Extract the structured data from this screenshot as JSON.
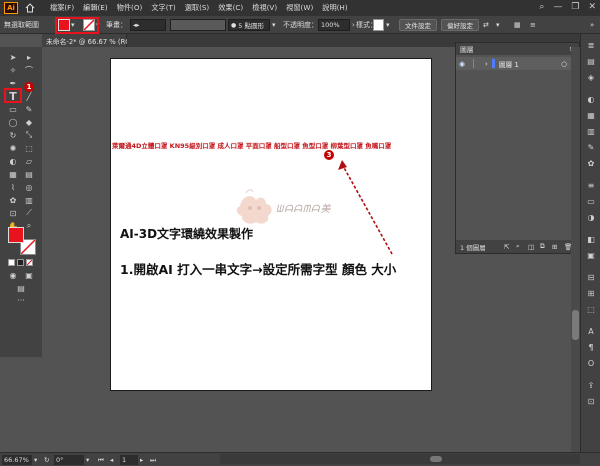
{
  "menubar": {
    "logo": "Ai",
    "items": [
      "檔案(F)",
      "編輯(E)",
      "物件(O)",
      "文字(T)",
      "選取(S)",
      "效果(C)",
      "檢視(V)",
      "視窗(W)",
      "說明(H)"
    ]
  },
  "controlbar": {
    "selection_label": "無選取範圍",
    "stroke_label": "筆畫：",
    "brush_label": "5 點圓形",
    "opacity_label": "不透明度：",
    "opacity_value": "100%",
    "style_label": "樣式：",
    "doc_setup_button": "文件設定",
    "prefs_button": "偏好設定"
  },
  "document": {
    "tab_title": "未命名-2* @ 66.67 % (RGB/預視)",
    "chain_text": "萊爾通4D立體口罩 KN95級別口罩 成人口罩 平面口罩 船型口罩 魚型口罩 柳葉型口罩 魚嘴口罩",
    "heading": "AI-3D文字環繞效果製作",
    "step": "1.開啟AI 打入一串文字→設定所需字型 顏色 大小",
    "watermark_text": "ᗯᗩᗩᗰᗩ美"
  },
  "badges": [
    "1",
    "2",
    "3"
  ],
  "layers_panel": {
    "title": "圖層",
    "layer_name": "圖層 1",
    "footer": "1 個圖層"
  },
  "statusbar": {
    "zoom": "66.67%",
    "rotation": "0°",
    "page": "1",
    "tool": "手形"
  },
  "colors": {
    "fill": "#e8131d",
    "accent_red": "#c3161b",
    "badge_red": "#c40000"
  }
}
